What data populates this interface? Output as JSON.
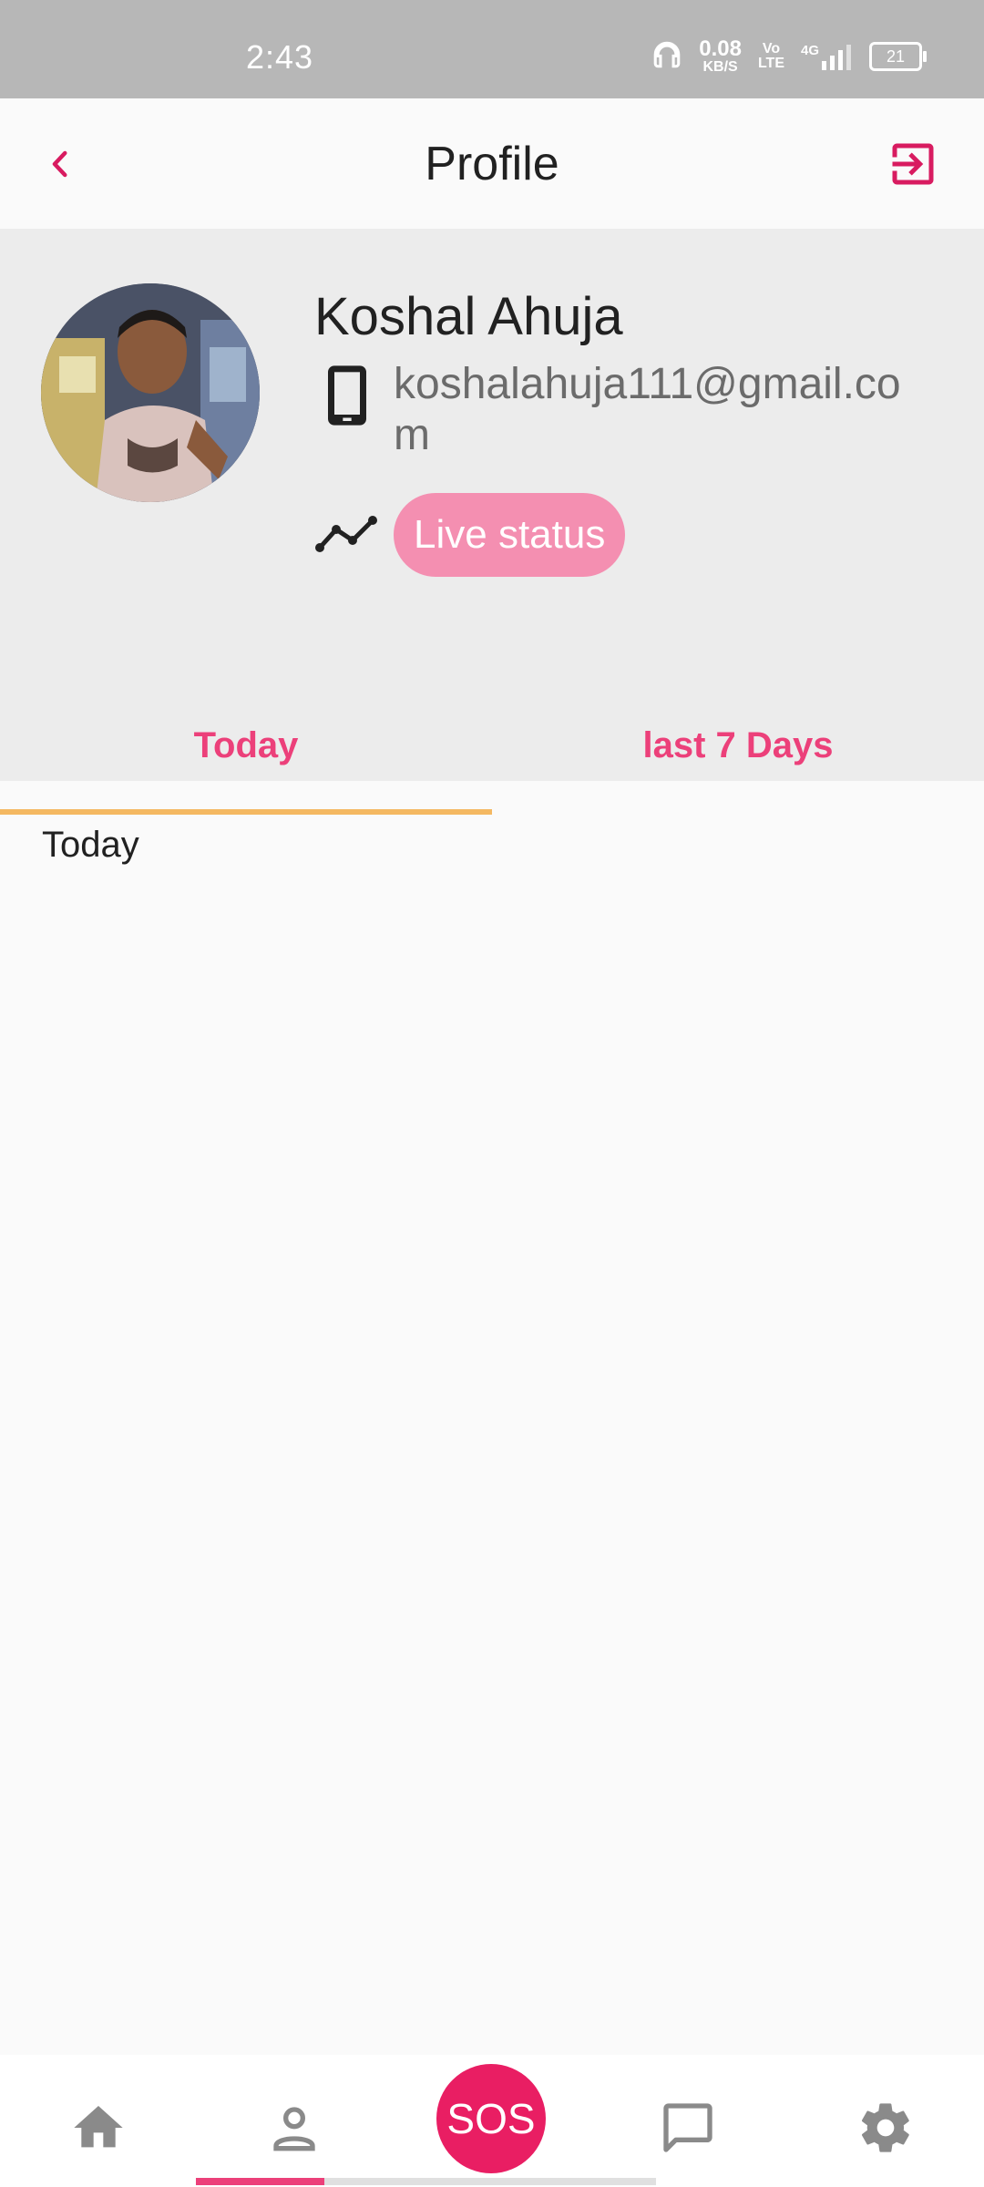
{
  "status_bar": {
    "time": "2:43",
    "net_speed_value": "0.08",
    "net_speed_unit": "KB/S",
    "volte_top": "Vo",
    "volte_bottom": "LTE",
    "network": "4G",
    "battery": "21"
  },
  "app_bar": {
    "title": "Profile",
    "back_icon": "chevron-left-icon",
    "logout_icon": "exit-icon"
  },
  "profile": {
    "name": "Koshal Ahuja",
    "email": "koshalahuja111@gmail.com",
    "live_status_label": "Live status"
  },
  "tabs": [
    {
      "label": "Today",
      "selected": true
    },
    {
      "label": "last 7 Days",
      "selected": false
    }
  ],
  "content": {
    "section_label": "Today"
  },
  "bottom_nav": {
    "items": [
      {
        "icon": "home-icon"
      },
      {
        "icon": "person-icon"
      },
      {
        "label": "SOS"
      },
      {
        "icon": "chat-icon"
      },
      {
        "icon": "gear-icon"
      }
    ],
    "progress": 0.28
  },
  "colors": {
    "accent": "#ec407a",
    "sos": "#e91e63",
    "live_status_bg": "#f48fb1",
    "tab_indicator": "#f4b861",
    "header_bg": "#ececec",
    "status_bar_bg": "#b7b7b7"
  }
}
